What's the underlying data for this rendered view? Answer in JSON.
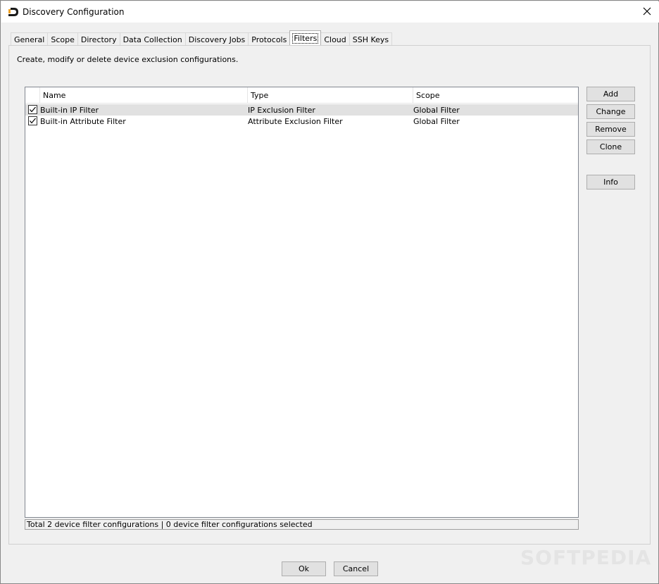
{
  "window": {
    "title": "Discovery Configuration",
    "close_glyph": "✕"
  },
  "tabs": [
    {
      "label": "General",
      "active": false
    },
    {
      "label": "Scope",
      "active": false
    },
    {
      "label": "Directory",
      "active": false
    },
    {
      "label": "Data Collection",
      "active": false
    },
    {
      "label": "Discovery Jobs",
      "active": false
    },
    {
      "label": "Protocols",
      "active": false
    },
    {
      "label": "Filters",
      "active": true
    },
    {
      "label": "Cloud",
      "active": false
    },
    {
      "label": "SSH Keys",
      "active": false
    }
  ],
  "panel": {
    "description": "Create, modify or delete device exclusion configurations."
  },
  "table": {
    "columns": [
      "Name",
      "Type",
      "Scope"
    ],
    "rows": [
      {
        "checked": true,
        "name": "Built-in IP Filter",
        "type": "IP Exclusion Filter",
        "scope": "Global Filter",
        "selected": true
      },
      {
        "checked": true,
        "name": "Built-in Attribute Filter",
        "type": "Attribute Exclusion Filter",
        "scope": "Global Filter",
        "selected": false
      }
    ],
    "status": "Total 2 device filter configurations | 0 device filter configurations selected"
  },
  "side_buttons": {
    "add": "Add",
    "change": "Change",
    "remove": "Remove",
    "clone": "Clone",
    "info": "Info"
  },
  "footer": {
    "ok": "Ok",
    "cancel": "Cancel"
  },
  "watermark": "SOFTPEDIA",
  "colors": {
    "selected_row": "#e1e1e1",
    "button_face": "#e1e1e1",
    "logo_accent": "#f0a020"
  }
}
